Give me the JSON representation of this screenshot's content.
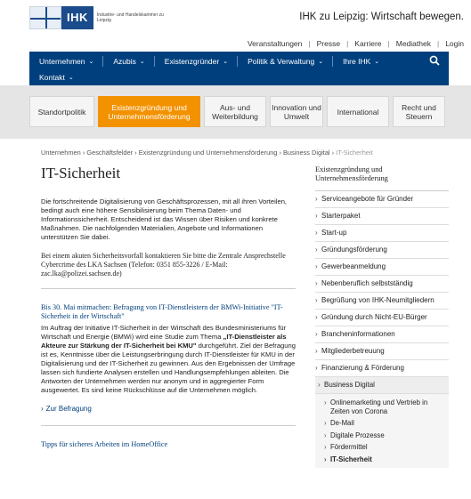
{
  "header": {
    "logo_text": "IHK",
    "logo_sub": "Industrie- und Handelskammer zu Leipzig",
    "tagline": "IHK zu Leipzig: Wirtschaft bewegen.",
    "utility_links": [
      "Veranstaltungen",
      "Presse",
      "Karriere",
      "Mediathek",
      "Login"
    ]
  },
  "mainnav": {
    "items": [
      "Unternehmen",
      "Azubis",
      "Existenzgründer",
      "Politik & Verwaltung",
      "Ihre IHK"
    ],
    "items_row2": [
      "Kontakt"
    ],
    "search_icon": "search-icon",
    "bg_color": "#003f7d"
  },
  "subnav": {
    "tabs": [
      {
        "label": "Standortpolitik",
        "active": false
      },
      {
        "label": "Existenzgründung und Unternehmensförderung",
        "active": true
      },
      {
        "label": "Aus- und Weiterbildung",
        "active": false
      },
      {
        "label": "Innovation und Umwelt",
        "active": false
      },
      {
        "label": "International",
        "active": false
      },
      {
        "label": "Recht und Steuern",
        "active": false
      }
    ],
    "active_color": "#f39200"
  },
  "breadcrumb": {
    "items": [
      "Unternehmen",
      "Geschäftsfelder",
      "Existenzgründung und Unternehmensförderung",
      "Business Digital"
    ],
    "current": "IT-Sicherheit"
  },
  "main": {
    "title": "IT-Sicherheit",
    "intro": "Die fortschreitende Digitalisierung von Geschäftsprozessen, mit all ihren Vorteilen, bedingt auch eine höhere Sensibilisierung beim Thema Daten- und Informationssicherheit. Entscheidend ist das Wissen über Risiken und konkrete Maßnahmen. Die nachfolgenden Materialien, Angebote und Informationen unterstützen Sie dabei.",
    "contact": "Bei einem akuten Sicherheitsvorfall kontaktieren Sie bitte die Zentrale Ansprechstelle Cybercrime des LKA Sachsen (Telefon: 0351 855-3226 / E-Mail: zac.lka@polizei.sachsen.de)",
    "article1": {
      "heading": "Bis 30. Mai mitmachen: Befragung von IT-Dienstleistern der BMWi-Initiative \"IT-Sicherheit in der Wirtschaft\"",
      "body_start": "Im Auftrag der Initiative IT-Sicherheit in der Wirtschaft des Bundesministeriums für Wirtschaft und Energie (BMWi) wird eine Studie zum Thema ",
      "body_bold": "„IT-Dienstleister als Akteure zur Stärkung der IT-Sicherheit bei KMU\"",
      "body_end": " durchgeführt. Ziel der Befragung ist es, Kenntnisse über die Leistungserbringung durch IT-Dienstleister für KMU in der Digitalisierung und der IT-Sicherheit zu gewinnen. Aus den Ergebnissen der Umfrage lassen sich fundierte Analysen erstellen und Handlungsempfehlungen ableiten. Die Antworten der Unternehmen werden nur anonym und in aggregierter Form ausgewertet. Es sind keine Rückschlüsse auf die Unternehmen möglich.",
      "link": "Zur Befragung"
    },
    "article2": {
      "heading": "Tipps für sicheres Arbeiten im HomeOffice"
    }
  },
  "sidebar": {
    "title": "Existenzgründung und Unternehmensförderung",
    "items": [
      "Serviceangebote für Gründer",
      "Starterpaket",
      "Start-up",
      "Gründungsförderung",
      "Gewerbeanmeldung",
      "Nebenberuflich selbstständig",
      "Begrüßung von IHK-Neumitgliedern",
      "Gründung durch Nicht-EU-Bürger",
      "Brancheninformationen",
      "Mitgliederbetreuung",
      "Finanzierung & Förderung"
    ],
    "active_item": "Business Digital",
    "subitems": [
      "Onlinemarketing und Vertrieb in Zeiten von Corona",
      "De-Mail",
      "Digitale Prozesse",
      "Fördermittel",
      "IT-Sicherheit"
    ]
  }
}
